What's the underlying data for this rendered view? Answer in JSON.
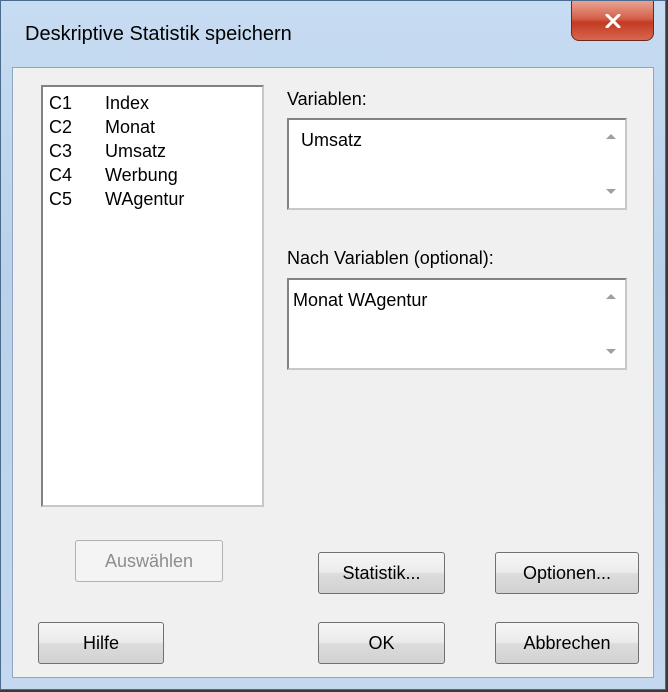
{
  "window": {
    "title": "Deskriptive Statistik speichern"
  },
  "variables_list": [
    {
      "col": "C1",
      "name": "Index"
    },
    {
      "col": "C2",
      "name": "Monat"
    },
    {
      "col": "C3",
      "name": "Umsatz"
    },
    {
      "col": "C4",
      "name": "Werbung"
    },
    {
      "col": "C5",
      "name": "WAgentur"
    }
  ],
  "variables_field": {
    "label": "Variablen:",
    "value": "Umsatz"
  },
  "by_variables_field": {
    "label": "Nach Variablen (optional):",
    "value": "Monat WAgentur"
  },
  "buttons": {
    "select": "Auswählen",
    "statistics": "Statistik...",
    "options": "Optionen...",
    "help": "Hilfe",
    "ok": "OK",
    "cancel": "Abbrechen"
  },
  "icons": {
    "close": "close-icon",
    "scroll_up": "scroll-up-arrow-icon",
    "scroll_down": "scroll-down-arrow-icon"
  },
  "colors": {
    "close_button": "#c23a22",
    "frame": "#b9d1ea",
    "client": "#f0f0f0"
  }
}
